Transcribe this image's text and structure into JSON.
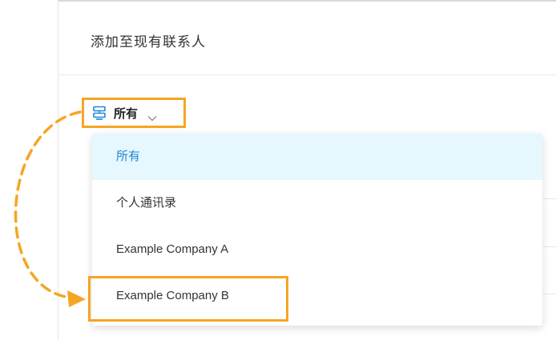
{
  "dialog": {
    "title": "添加至现有联系人"
  },
  "filter": {
    "selected_label": "所有",
    "icon": "contact-book-icon",
    "chevron_icon": "chevron-down-icon"
  },
  "dropdown": {
    "items": [
      {
        "label": "所有",
        "selected": true
      },
      {
        "label": "个人通讯录",
        "selected": false
      },
      {
        "label": "Example Company A",
        "selected": false
      },
      {
        "label": "Example Company B",
        "selected": false
      }
    ]
  },
  "colors": {
    "highlight": "#f5a623",
    "selected_text": "#1e88d6",
    "selected_bg": "#e6f7fd"
  }
}
